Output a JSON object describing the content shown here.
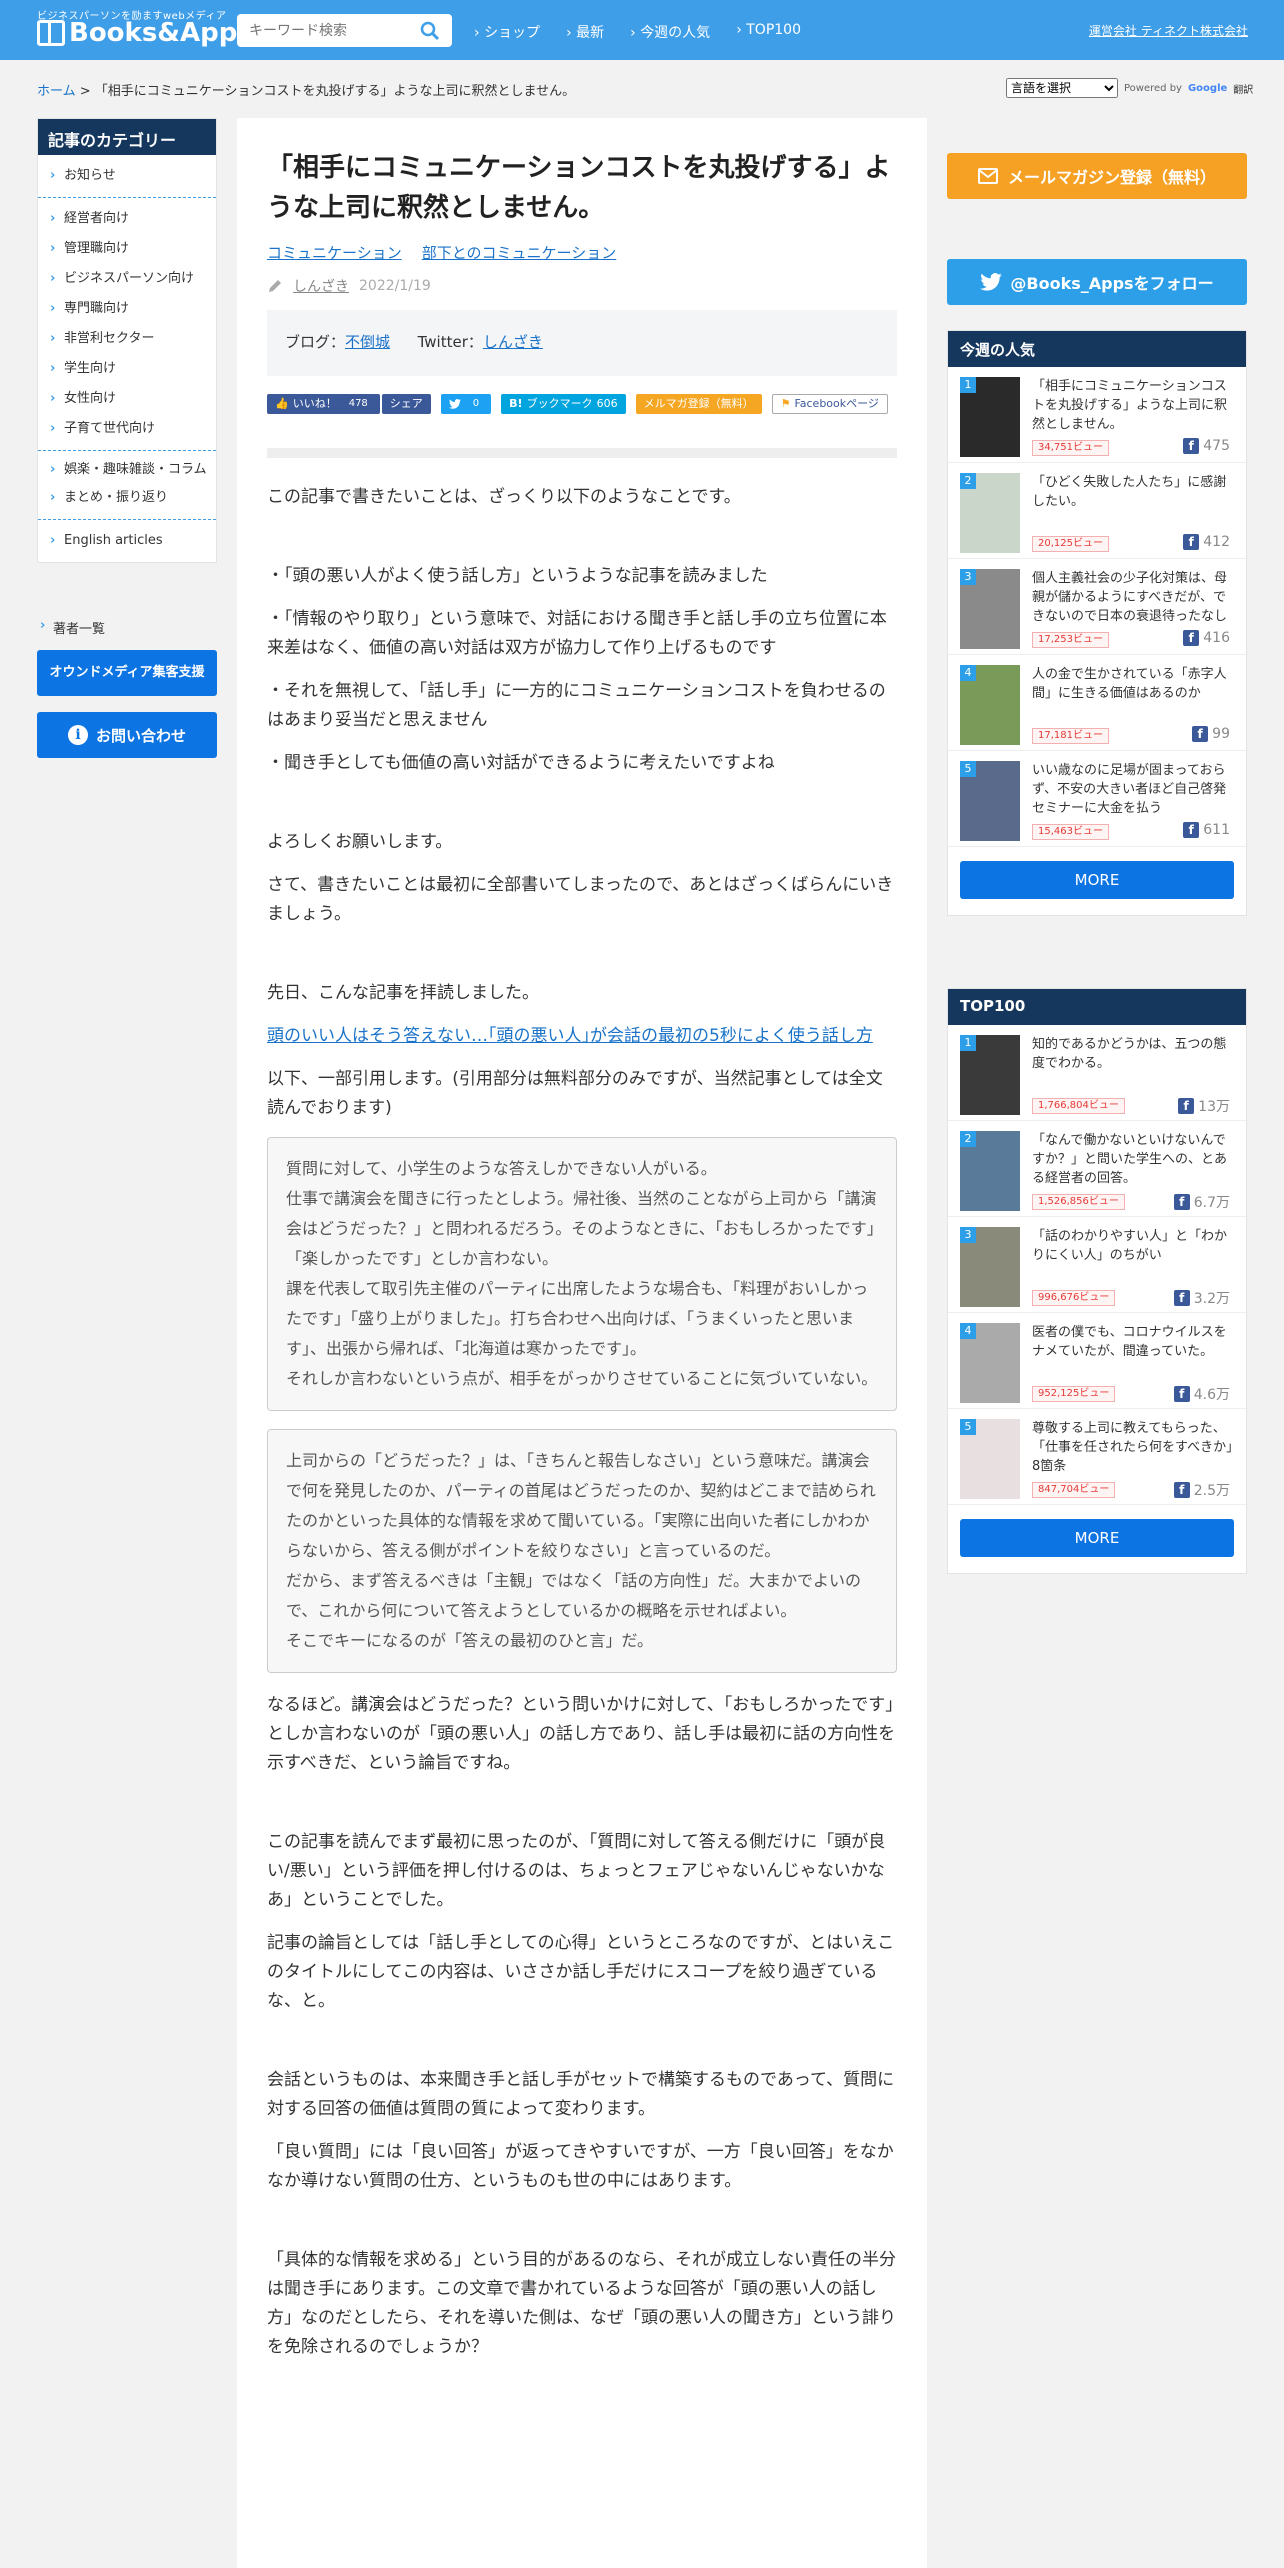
{
  "header": {
    "tagline": "ビジネスパーソンを励ますwebメディア",
    "logo": "Books&Apps",
    "search_placeholder": "キーワード検索",
    "nav": [
      "ショップ",
      "最新",
      "今週の人気",
      "TOP100"
    ],
    "company_link": "運営会社 ティネクト株式会社"
  },
  "breadcrumb": {
    "home": "ホーム",
    "sep": " > ",
    "current": "「相手にコミュニケーションコストを丸投げする」ような上司に釈然としません。"
  },
  "translate": {
    "select": "言語を選択",
    "powered_by": "Powered by",
    "google": "Google",
    "translate": "翻訳"
  },
  "categories": {
    "title": "記事のカテゴリー",
    "group1": [
      "お知らせ"
    ],
    "group2": [
      "経営者向け",
      "管理職向け",
      "ビジネスパーソン向け",
      "専門職向け",
      "非営利セクター",
      "学生向け",
      "女性向け",
      "子育て世代向け"
    ],
    "group3": [
      "娯楽・趣味雑談・コラム",
      "まとめ・振り返り"
    ],
    "group4": [
      "English articles"
    ]
  },
  "authors_link": "著者一覧",
  "owned_media_button": "オウンドメディア集客支援",
  "contact_button": "お問い合わせ",
  "article": {
    "title": "「相手にコミュニケーションコストを丸投げする」ような上司に釈然としません。",
    "tags": [
      "コミュニケーション",
      "部下とのコミュニケーション"
    ],
    "author": "しんざき",
    "date": "2022/1/19",
    "blog_label": "ブログ：",
    "blog_name": "不倒城",
    "twitter_label": "Twitter：",
    "twitter_name": "しんざき",
    "share": {
      "like": "いいね！",
      "like_count": "478",
      "share": "シェア",
      "tweet_count": "0",
      "hatena": "ブックマーク",
      "hatena_count": "606",
      "mail": "メルマガ登録（無料）",
      "fb_page": "Facebookページ"
    },
    "p1": "この記事で書きたいことは、ざっくり以下のようなことです。",
    "bullets": [
      "・「頭の悪い人がよく使う話し方」というような記事を読みました",
      "・「情報のやり取り」という意味で、対話における聞き手と話し手の立ち位置に本来差はなく、価値の高い対話は双方が協力して作り上げるものです",
      "・それを無視して、「話し手」に一方的にコミュニケーションコストを負わせるのはあまり妥当だと思えません",
      "・聞き手としても価値の高い対話ができるように考えたいですよね"
    ],
    "p2": "よろしくお願いします。",
    "p3": "さて、書きたいことは最初に全部書いてしまったので、あとはざっくばらんにいきましょう。",
    "p4": "先日、こんな記事を拝読しました。",
    "link": "頭のいい人はそう答えない…｢頭の悪い人｣が会話の最初の5秒によく使う話し方",
    "p5": "以下、一部引用します。(引用部分は無料部分のみですが、当然記事としては全文読んでおります)",
    "quote1": [
      "質問に対して、小学生のような答えしかできない人がいる。",
      "仕事で講演会を聞きに行ったとしよう。帰社後、当然のことながら上司から「講演会はどうだった？」と問われるだろう。そのようなときに、「おもしろかったです」「楽しかったです」としか言わない。",
      "課を代表して取引先主催のパーティに出席したような場合も、「料理がおいしかったです」「盛り上がりました」。打ち合わせへ出向けば、「うまくいったと思います」、出張から帰れば、「北海道は寒かったです」。",
      "それしか言わないという点が、相手をがっかりさせていることに気づいていない。"
    ],
    "quote2": [
      "上司からの「どうだった？」は、「きちんと報告しなさい」という意味だ。講演会で何を発見したのか、パーティの首尾はどうだったのか、契約はどこまで詰められたのかといった具体的な情報を求めて聞いている。「実際に出向いた者にしかわからないから、答える側がポイントを絞りなさい」と言っているのだ。",
      "だから、まず答えるべきは「主観」ではなく「話の方向性」だ。大まかでよいので、これから何について答えようとしているかの概略を示せればよい。",
      "そこでキーになるのが「答えの最初のひと言」だ。"
    ],
    "p6": "なるほど。講演会はどうだった？という問いかけに対して、「おもしろかったです」としか言わないのが「頭の悪い人」の話し方であり、話し手は最初に話の方向性を示すべきだ、という論旨ですね。",
    "p7": "この記事を読んでまず最初に思ったのが、「質問に対して答える側だけに「頭が良い/悪い」という評価を押し付けるのは、ちょっとフェアじゃないんじゃないかなあ」ということでした。",
    "p8": "記事の論旨としては「話し手としての心得」というところなのですが、とはいえこのタイトルにしてこの内容は、いささか話し手だけにスコープを絞り過ぎているな、と。",
    "p9": "会話というものは、本来聞き手と話し手がセットで構築するものであって、質問に対する回答の価値は質問の質によって変わります。",
    "p10": "「良い質問」には「良い回答」が返ってきやすいですが、一方「良い回答」をなかなか導けない質問の仕方、というものも世の中にはあります。",
    "p11": "「具体的な情報を求める」という目的があるのなら、それが成立しない責任の半分は聞き手にあります。この文章で書かれているような回答が「頭の悪い人の話し方」なのだとしたら、それを導いた側は、なぜ「頭の悪い人の聞き方」という誹りを免除されるのでしょうか？"
  },
  "sidebar_right": {
    "mail_button": "メールマガジン登録（無料）",
    "twitter_button": "@Books_Appsをフォロー",
    "weekly": {
      "title": "今週の人気",
      "items": [
        {
          "rank": "1",
          "title": "「相手にコミュニケーションコストを丸投げする」ような上司に釈然としません。",
          "views": "34,751ビュー",
          "fb": "475"
        },
        {
          "rank": "2",
          "title": "「ひどく失敗した人たち」に感謝したい。",
          "views": "20,125ビュー",
          "fb": "412"
        },
        {
          "rank": "3",
          "title": "個人主義社会の少子化対策は、母親が儲かるようにすべきだが、できないので日本の衰退待ったなし",
          "views": "17,253ビュー",
          "fb": "416"
        },
        {
          "rank": "4",
          "title": "人の金で生かされている「赤字人間」に生きる価値はあるのか",
          "views": "17,181ビュー",
          "fb": "99"
        },
        {
          "rank": "5",
          "title": "いい歳なのに足場が固まっておらず、不安の大きい者ほど自己啓発セミナーに大金を払う",
          "views": "15,463ビュー",
          "fb": "611"
        }
      ],
      "more": "MORE"
    },
    "top100": {
      "title": "TOP100",
      "items": [
        {
          "rank": "1",
          "title": "知的であるかどうかは、五つの態度でわかる。",
          "views": "1,766,804ビュー",
          "fb": "13万"
        },
        {
          "rank": "2",
          "title": "「なんで働かないといけないんですか？」と問いた学生への、とある経営者の回答。",
          "views": "1,526,856ビュー",
          "fb": "6.7万"
        },
        {
          "rank": "3",
          "title": "「話のわかりやすい人」と「わかりにくい人」のちがい",
          "views": "996,676ビュー",
          "fb": "3.2万"
        },
        {
          "rank": "4",
          "title": "医者の僕でも、コロナウイルスをナメていたが、間違っていた。",
          "views": "952,125ビュー",
          "fb": "4.6万"
        },
        {
          "rank": "5",
          "title": "尊敬する上司に教えてもらった、「仕事を任されたら何をすべきか」8箇条",
          "views": "847,704ビュー",
          "fb": "2.5万"
        }
      ],
      "more": "MORE"
    }
  }
}
